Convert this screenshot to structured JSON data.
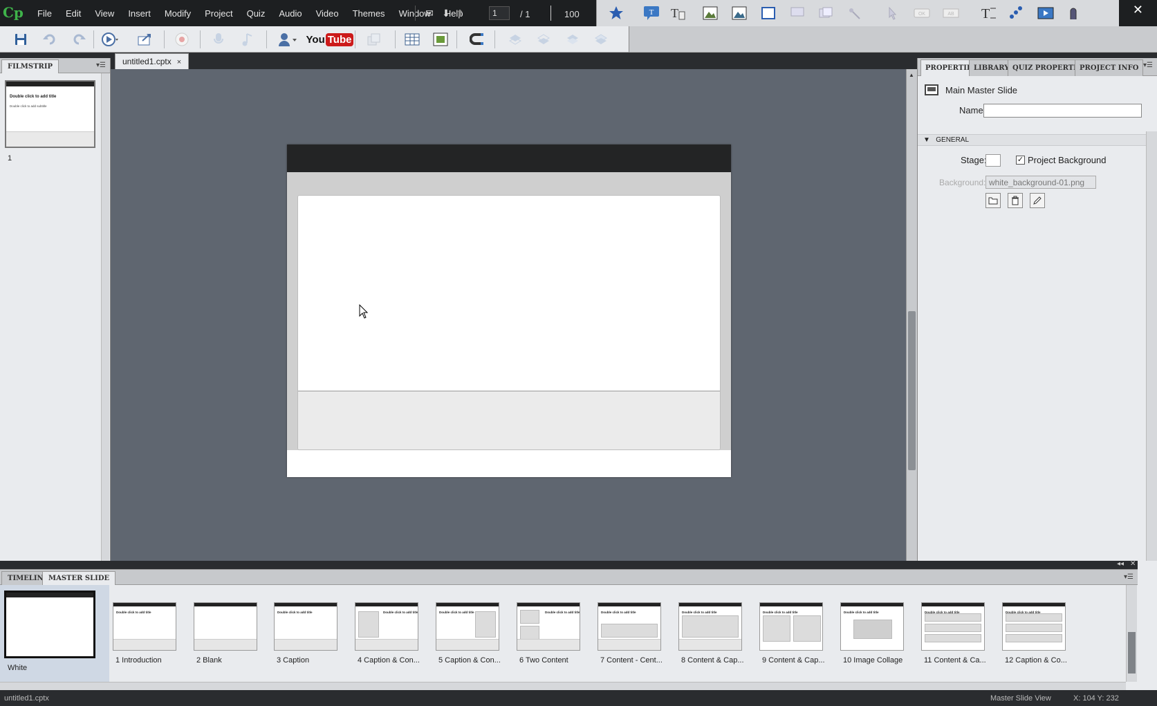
{
  "app": {
    "logo": "Cp",
    "close_glyph": "✕"
  },
  "menu": [
    "File",
    "Edit",
    "View",
    "Insert",
    "Modify",
    "Project",
    "Quiz",
    "Audio",
    "Video",
    "Themes",
    "Window",
    "Help"
  ],
  "slide_nav": {
    "current": "1",
    "total": "/  1",
    "zoom": "100"
  },
  "toolbar": {
    "youtube_label": "You",
    "youtube_tube": "Tube"
  },
  "filmstrip": {
    "tab": "FILMSTRIP",
    "thumb_title": "Double click to add title",
    "thumb_subtitle": "Double click to add subtitle",
    "slide_number": "1"
  },
  "document": {
    "tab_label": "untitled1.cptx",
    "tab_close": "×"
  },
  "properties": {
    "tabs": [
      "PROPERTIES",
      "LIBRARY",
      "QUIZ PROPERTIES",
      "PROJECT INFO"
    ],
    "object_title": "Main Master Slide",
    "name_label": "Name:",
    "name_value": "",
    "section": "GENERAL",
    "stage_label": "Stage:",
    "project_background_label": "Project Background",
    "project_background_checked": true,
    "background_label": "Background:",
    "background_value": "white_background-01.png"
  },
  "bottom_panel": {
    "tabs": [
      "TIMELINE",
      "MASTER SLIDE"
    ],
    "current_master": "White",
    "layouts": [
      "1 Introduction",
      "2 Blank",
      "3 Caption",
      "4 Caption & Con...",
      "5 Caption & Con...",
      "6 Two Content",
      "7 Content - Cent...",
      "8 Content & Cap...",
      "9 Content & Cap...",
      "10 Image Collage",
      "11 Content & Ca...",
      "12 Caption & Co..."
    ],
    "layout_thumb_title": "Double click to add title"
  },
  "status": {
    "file": "untitled1.cptx",
    "mode": "Master Slide View",
    "coord": "X: 104 Y: 232"
  }
}
